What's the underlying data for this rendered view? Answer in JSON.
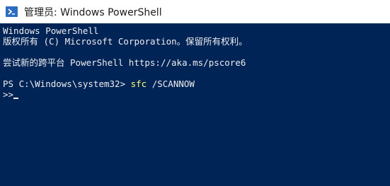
{
  "window": {
    "title": "管理员: Windows PowerShell",
    "icon": "powershell-icon"
  },
  "console": {
    "line1": "Windows PowerShell",
    "line2": "版权所有 (C) Microsoft Corporation。保留所有权利。",
    "line3": "尝试新的跨平台 PowerShell https://aka.ms/pscore6",
    "prompt": "PS C:\\Windows\\system32> ",
    "command": "sfc",
    "argument": " /SCANNOW",
    "continuation": ">>",
    "colors": {
      "background": "#012456",
      "text": "#eeedf0",
      "command": "#ffff66"
    }
  }
}
